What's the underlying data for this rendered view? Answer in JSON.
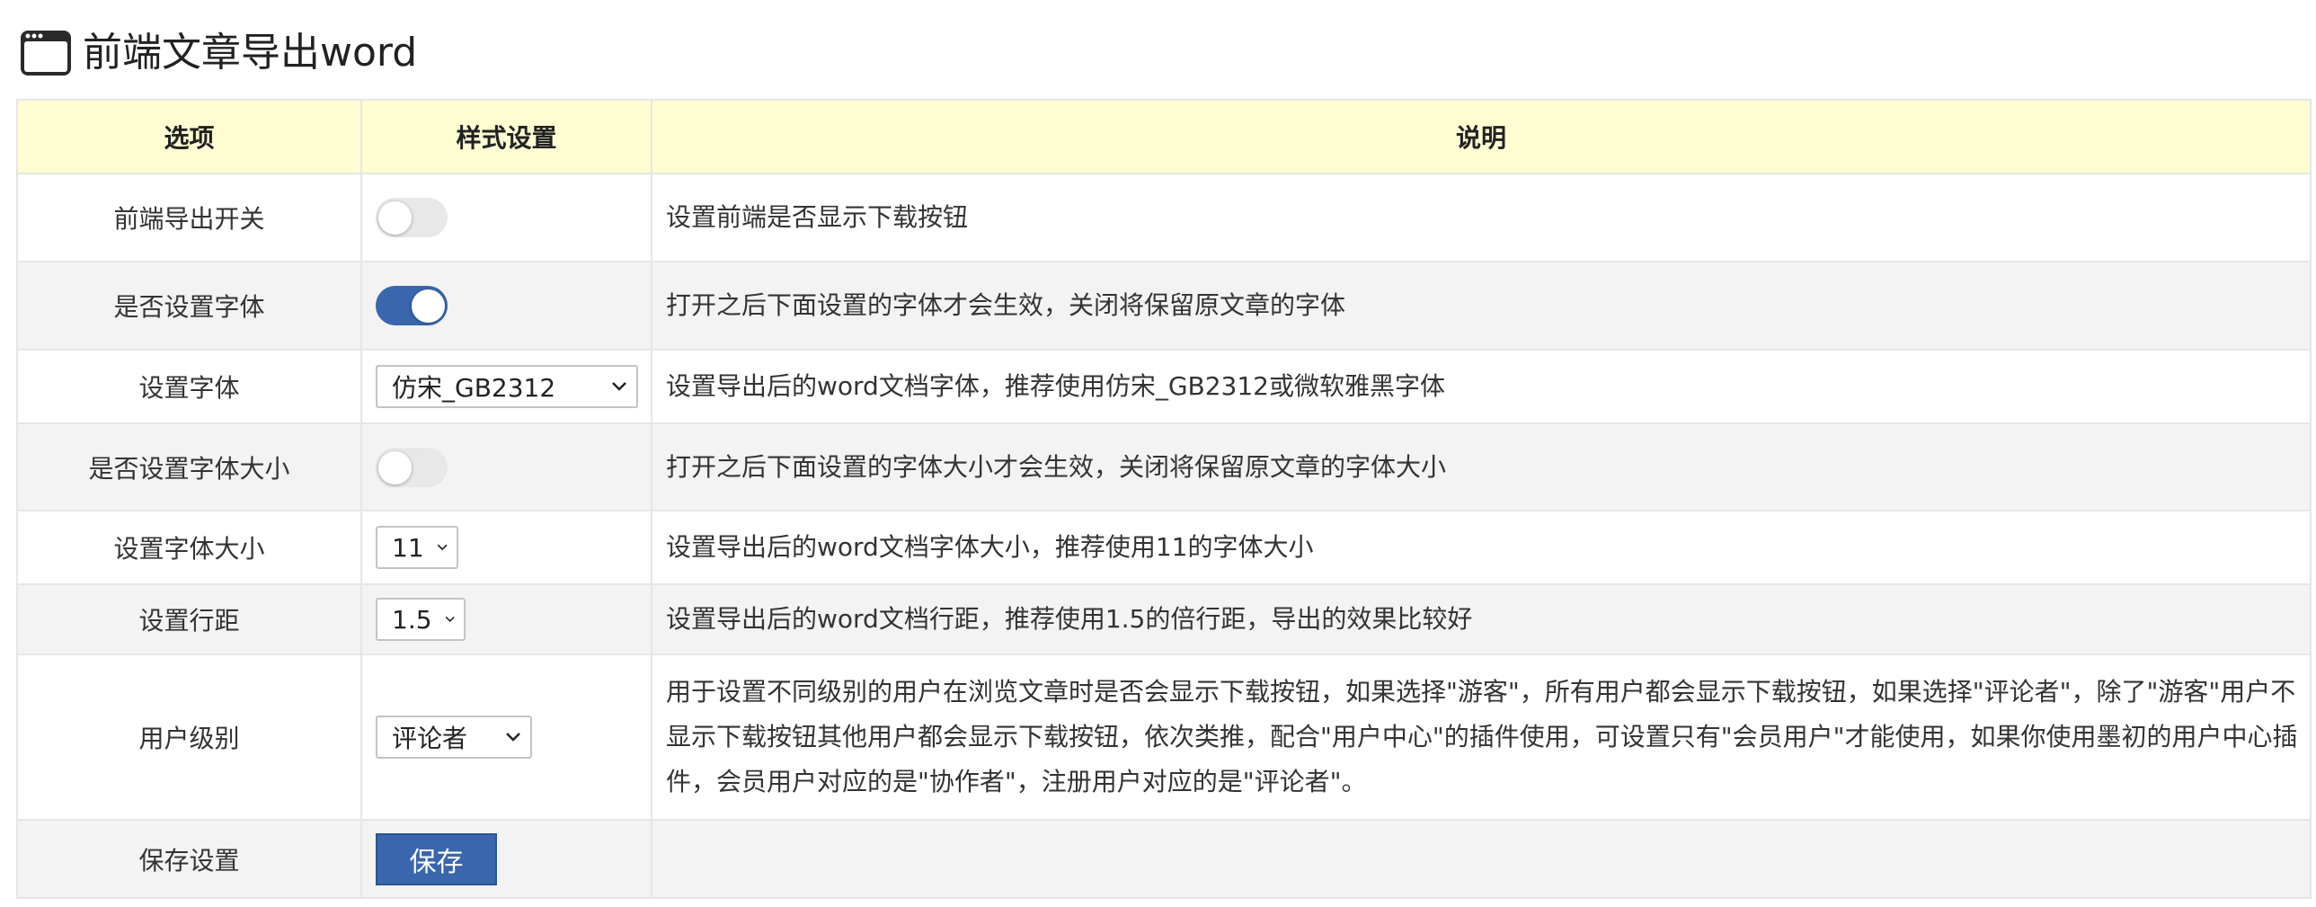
{
  "header": {
    "title": "前端文章导出word",
    "icon": "app-window-icon"
  },
  "table": {
    "columns": [
      "选项",
      "样式设置",
      "说明"
    ],
    "rows": [
      {
        "option": "前端导出开关",
        "control": "toggle",
        "value": "off",
        "description": "设置前端是否显示下载按钮"
      },
      {
        "option": "是否设置字体",
        "control": "toggle",
        "value": "on",
        "description": "打开之后下面设置的字体才会生效，关闭将保留原文章的字体"
      },
      {
        "option": "设置字体",
        "control": "select",
        "value": "仿宋_GB2312",
        "description": "设置导出后的word文档字体，推荐使用仿宋_GB2312或微软雅黑字体"
      },
      {
        "option": "是否设置字体大小",
        "control": "toggle",
        "value": "off",
        "description": "打开之后下面设置的字体大小才会生效，关闭将保留原文章的字体大小"
      },
      {
        "option": "设置字体大小",
        "control": "select",
        "value": "11",
        "description": "设置导出后的word文档字体大小，推荐使用11的字体大小"
      },
      {
        "option": "设置行距",
        "control": "select",
        "value": "1.5",
        "description": "设置导出后的word文档行距，推荐使用1.5的倍行距，导出的效果比较好"
      },
      {
        "option": "用户级别",
        "control": "select",
        "value": "评论者",
        "description": "用于设置不同级别的用户在浏览文章时是否会显示下载按钮，如果选择\"游客\"，所有用户都会显示下载按钮，如果选择\"评论者\"，除了\"游客\"用户不显示下载按钮其他用户都会显示下载按钮，依次类推，配合\"用户中心\"的插件使用，可设置只有\"会员用户\"才能使用，如果你使用墨初的用户中心插件，会员用户对应的是\"协作者\"，注册用户对应的是\"评论者\"。"
      },
      {
        "option": "保存设置",
        "control": "button",
        "value": "保存",
        "description": ""
      }
    ]
  },
  "colors": {
    "accent": "#3a66ad",
    "header_bg": "#fefed2",
    "stripe_bg": "#f3f3f3",
    "toggle_off": "#e8e8e8"
  }
}
